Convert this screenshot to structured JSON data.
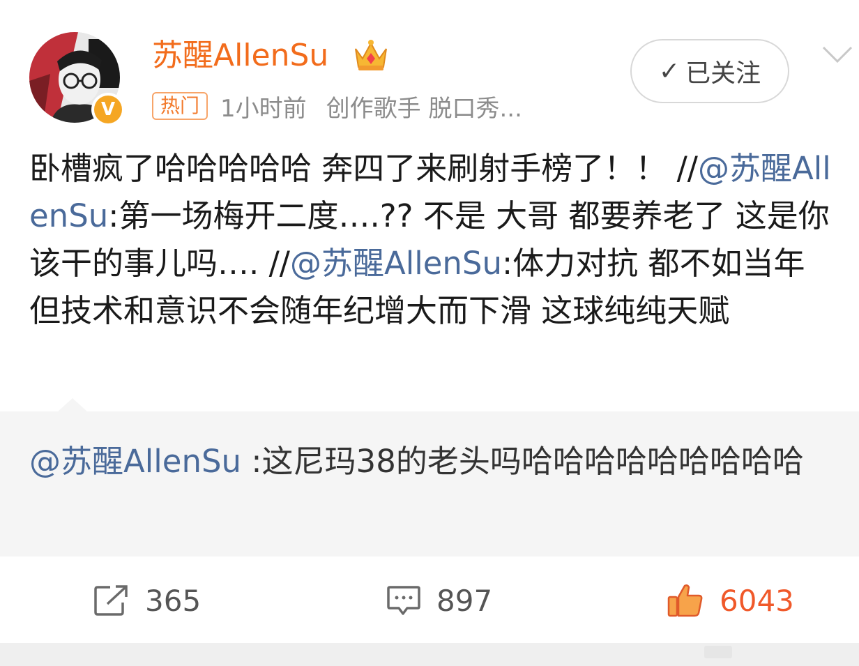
{
  "header": {
    "username": "苏醒AllenSu",
    "hot_badge": "热门",
    "time": "1小时前",
    "tags": "创作歌手 脱口秀...",
    "follow_label": "已关注",
    "follow_check": "✓",
    "verified_letter": "V"
  },
  "post": {
    "part1": "卧槽疯了哈哈哈哈哈 奔四了来刷射手榜了！！ //",
    "mention1": "@苏醒AllenSu",
    "part2": ":第一场梅开二度….?? 不是 大哥 都要养老了 这是你该干的事儿吗…. //",
    "mention2": "@苏醒AllenSu",
    "part3": ":体力对抗 都不如当年 但技术和意识不会随年纪增大而下滑 这球纯纯天赋"
  },
  "repost": {
    "mention": "@苏醒AllenSu",
    "text": " :这尼玛38的老头吗哈哈哈哈哈哈哈哈哈"
  },
  "actions": {
    "repost_count": "365",
    "comment_count": "897",
    "like_count": "6043"
  },
  "colors": {
    "username": "#f26c1c",
    "mention": "#4a6a9a",
    "like": "#f0592a"
  }
}
